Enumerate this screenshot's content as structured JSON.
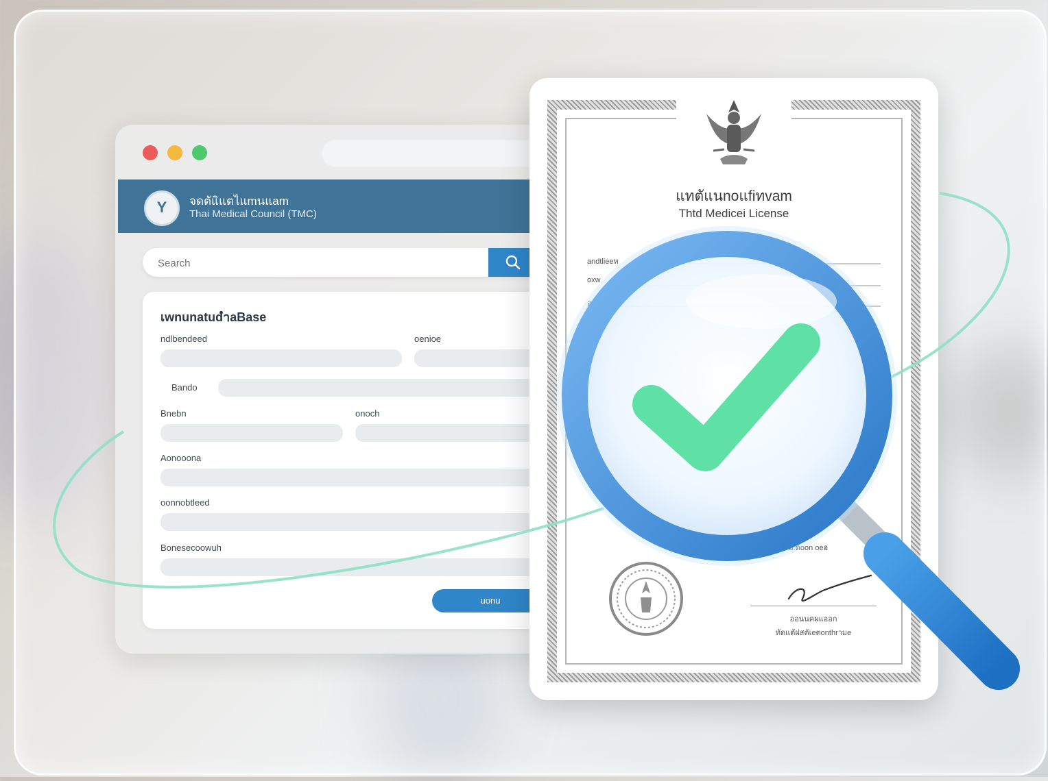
{
  "browser": {
    "header": {
      "title_th": "จดตัแิแตไแmนแam",
      "title_en": "Thai Medical Council (TMC)"
    },
    "search": {
      "placeholder": "Search"
    },
    "form": {
      "title": "เwnunatudำaBase",
      "labels": {
        "f1": "ndlbendeed",
        "f2": "oenioe",
        "f3": "Bando",
        "f4": "Bnebn",
        "f5": "onoch",
        "f6": "Aonooona",
        "f7": "oonnobtleed",
        "f8": "Bonesecoowuh"
      },
      "submit_label": "uonu"
    }
  },
  "certificate": {
    "title_th": "แทตัแนnoแfiทvam",
    "title_en": "Thtd Medicei License",
    "field_label_1": "andtlieeห",
    "field_label_2": "oxw",
    "field_label_3": "อ",
    "small_text": "ฮ.ดoon oeฮ",
    "signature_name": "ออนนคผแออก",
    "signature_title": "ทัดแตัฝสตัเeตonthrามe"
  },
  "colors": {
    "header_blue": "#3f7498",
    "accent_blue": "#2f86c9",
    "check_green": "#5fe0a4",
    "orbit_teal": "#8fe0c4"
  },
  "icons": {
    "search": "search-icon",
    "logo": "council-logo-icon",
    "emblem": "garuda-emblem-icon",
    "seal": "seal-stamp-icon",
    "magnifier": "magnifier-icon",
    "check": "check-icon"
  }
}
